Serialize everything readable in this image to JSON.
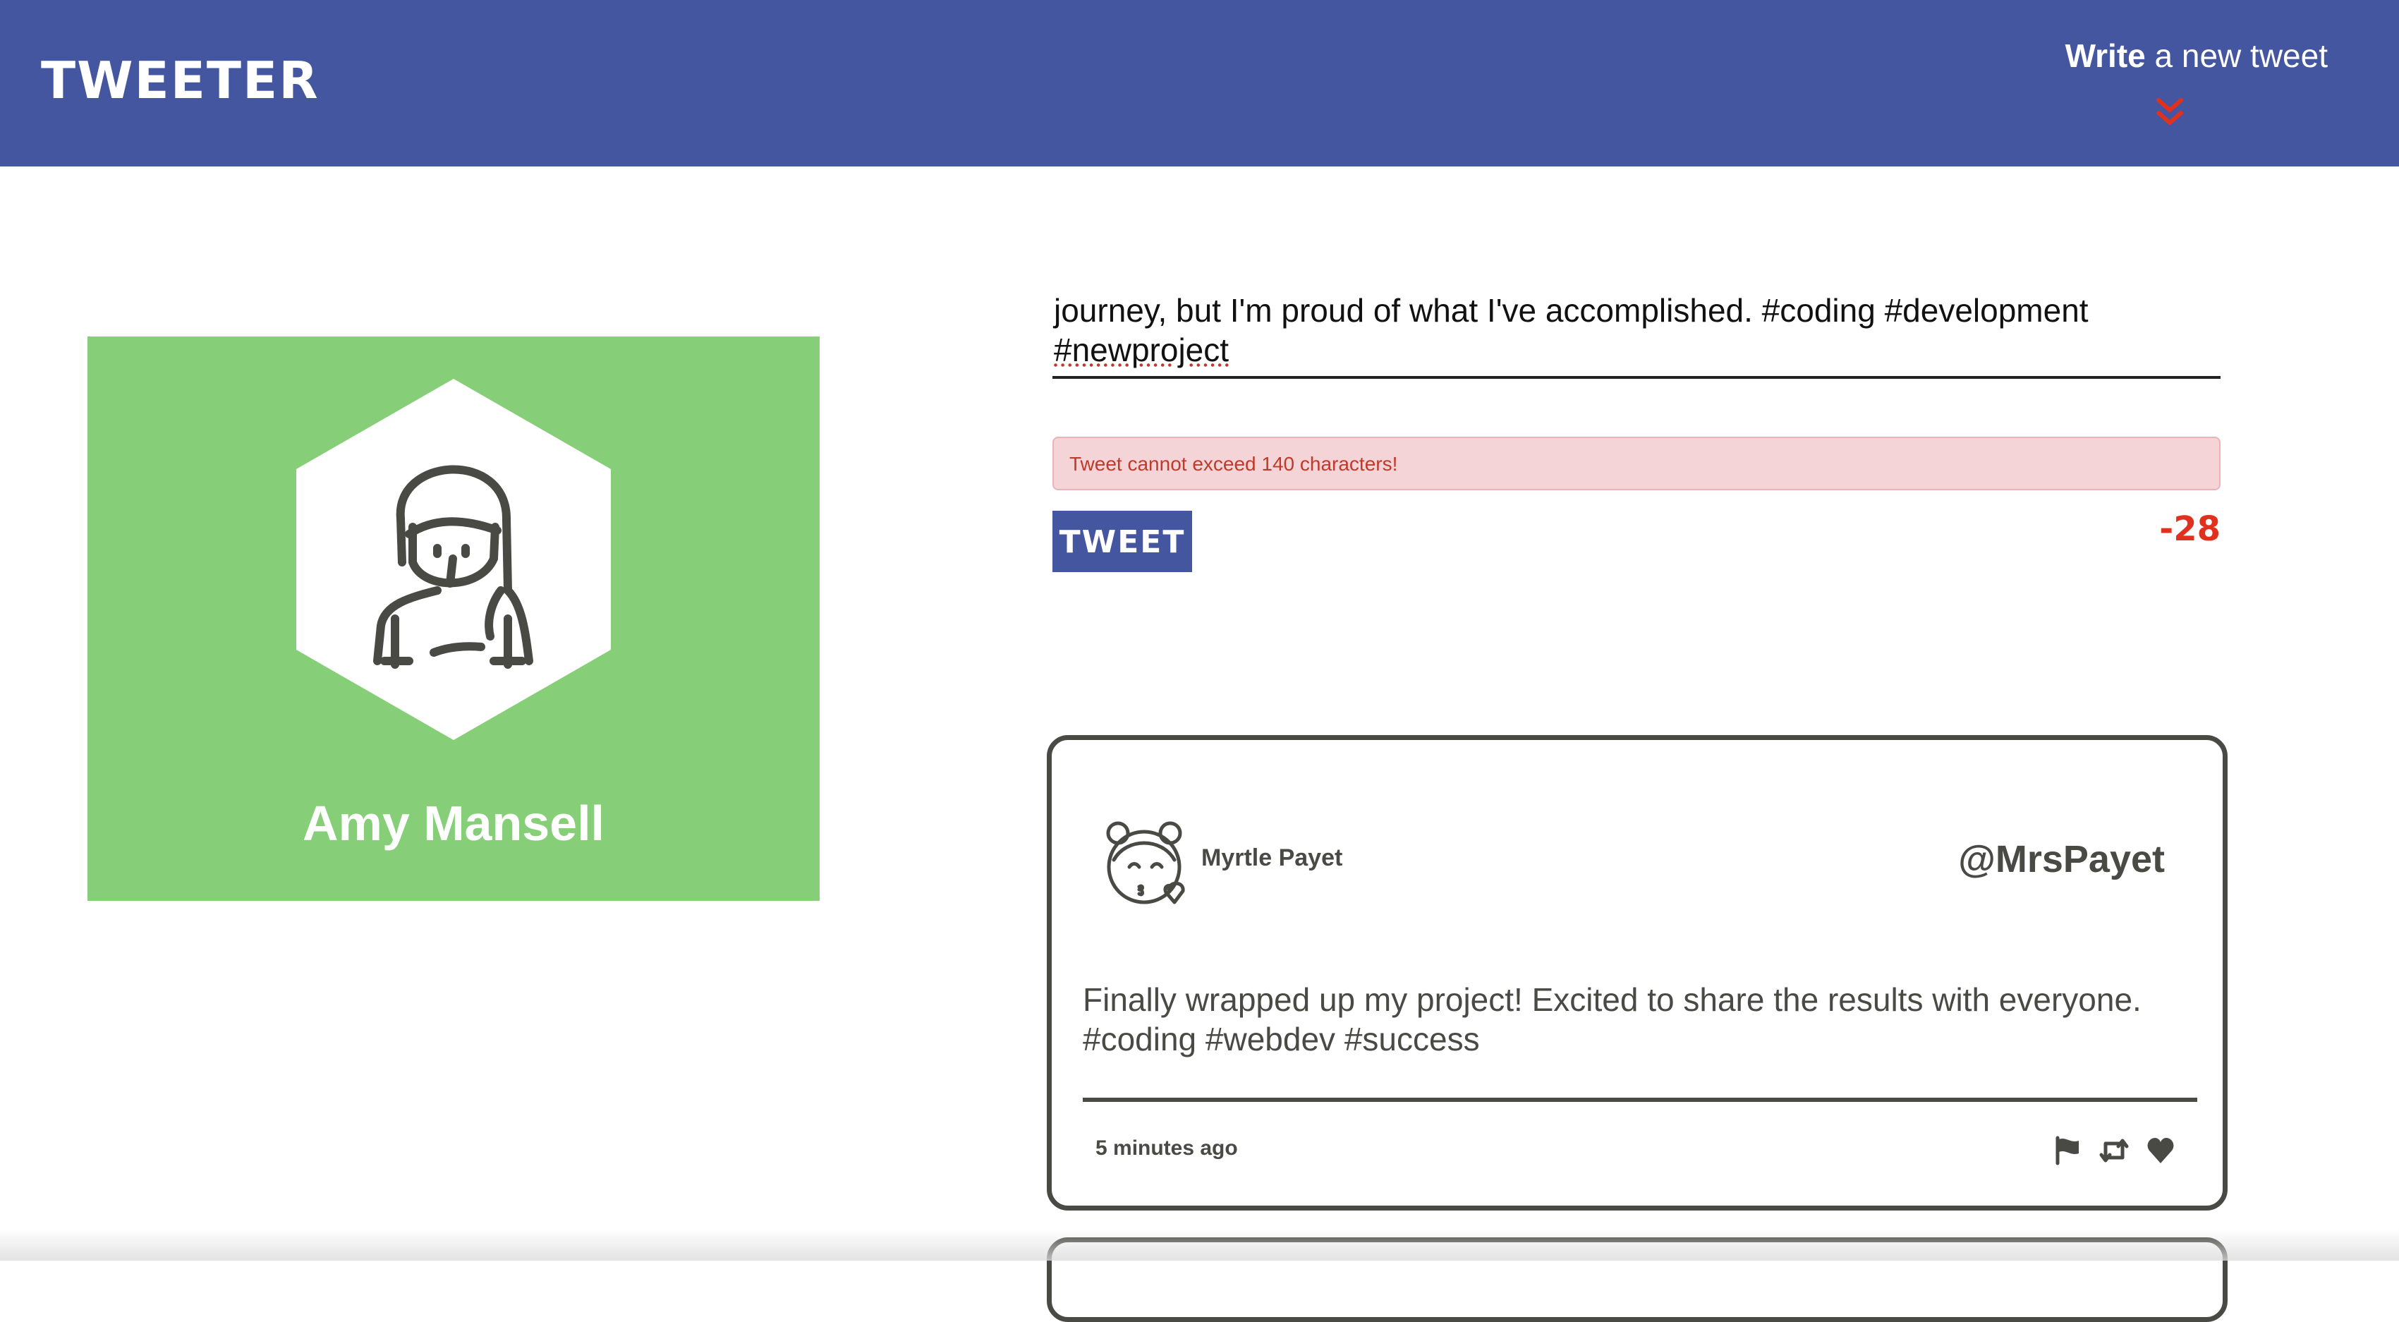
{
  "nav": {
    "logo": "TWEETER",
    "compose_bold": "Write",
    "compose_rest": " a new tweet",
    "compose_icon": "double-chevron-down-icon",
    "color": "#4556a0",
    "accent": "#e0301e"
  },
  "profile": {
    "name": "Amy Mansell",
    "avatar_icon": "woman-avatar-icon",
    "background": "#86cf78"
  },
  "composer": {
    "text_line1": "journey, but I'm proud of what I've accomplished. #coding #development",
    "text_line2": "#newproject",
    "error": "Tweet cannot exceed 140 characters!",
    "submit_label": "TWEET",
    "counter": "-28"
  },
  "tweets": [
    {
      "name": "Myrtle Payet",
      "handle": "@MrsPayet",
      "avatar_icon": "girl-kiss-avatar-icon",
      "text": "Finally wrapped up my project! Excited to share the results with everyone. #coding #webdev #success",
      "time": "5 minutes ago",
      "actions": [
        "flag-icon",
        "retweet-icon",
        "heart-icon"
      ]
    }
  ]
}
